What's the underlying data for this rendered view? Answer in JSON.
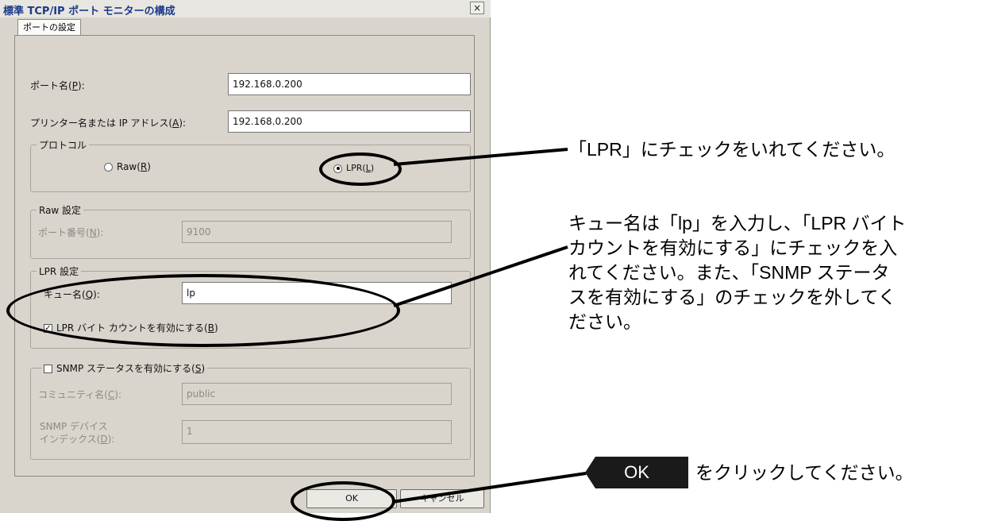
{
  "dialog": {
    "title": "標準 TCP/IP ポート モニターの構成",
    "close_glyph": "×",
    "tab": "ポートの設定",
    "port_name": {
      "label": "ポート名(",
      "key": "P",
      "suffix": "):",
      "value": "192.168.0.200"
    },
    "printer_address": {
      "label": "プリンター名または IP アドレス(",
      "key": "A",
      "suffix": "):",
      "value": "192.168.0.200"
    },
    "protocol": {
      "legend": "プロトコル",
      "raw": {
        "label": "Raw(",
        "key": "R",
        "suffix": ")",
        "selected": false
      },
      "lpr": {
        "label": "LPR(",
        "key": "L",
        "suffix": ")",
        "selected": true
      }
    },
    "raw_settings": {
      "legend": "Raw 設定",
      "port_number": {
        "label": "ポート番号(",
        "key": "N",
        "suffix": "):",
        "value": "9100"
      }
    },
    "lpr_settings": {
      "legend": "LPR 設定",
      "queue_name": {
        "label": "キュー名(",
        "key": "Q",
        "suffix": "):",
        "value": "lp"
      },
      "byte_count": {
        "label": "LPR バイト カウントを有効にする(",
        "key": "B",
        "suffix": ")",
        "checked": true
      }
    },
    "snmp": {
      "legend": "SNMP ステータスを有効にする(",
      "key": "S",
      "suffix": ")",
      "checked": false,
      "community": {
        "label": "コミュニティ名(",
        "key": "C",
        "suffix": "):",
        "value": "public"
      },
      "device_index": {
        "label_line1": "SNMP デバイス",
        "label_line2": "インデックス(",
        "key": "D",
        "suffix": "):",
        "value": "1"
      }
    },
    "buttons": {
      "ok": "OK",
      "cancel": "キャンセル"
    }
  },
  "callouts": {
    "lpr": "「LPR」にチェックをいれてください。",
    "queue": [
      "キュー名は「lp」を入力し、「LPR バイト",
      "カウントを有効にする」にチェックを入",
      "れてください。また、「SNMP ステータ",
      "スを有効にする」のチェックを外してく",
      "ださい。"
    ],
    "ok_chip": "OK",
    "ok_text": "をクリックしてください。"
  }
}
